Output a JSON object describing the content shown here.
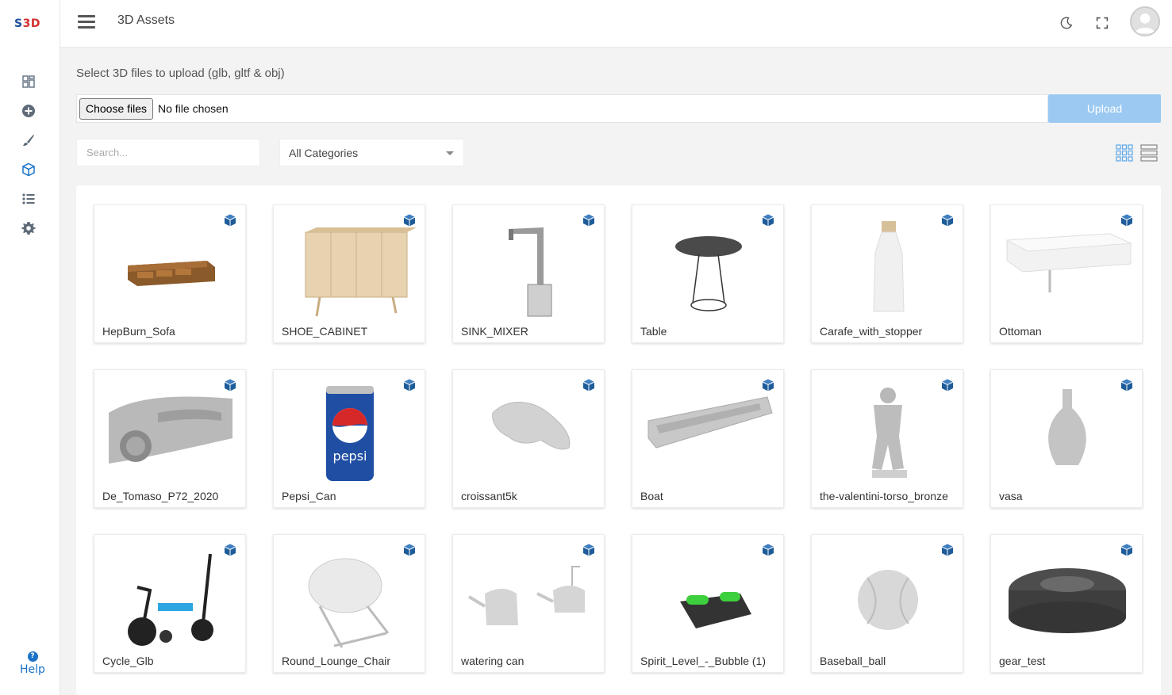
{
  "logo": {
    "text_a": "S",
    "text_b": "3D"
  },
  "header": {
    "title": "3D Assets"
  },
  "sidebar": {
    "icons": [
      "dashboard-icon",
      "add-circle-icon",
      "brush-icon",
      "cube-icon",
      "list-icon",
      "gear-icon"
    ],
    "help_label": "Help"
  },
  "upload": {
    "label": "Select 3D files to upload (glb, gltf & obj)",
    "choose_label": "Choose files",
    "no_file_label": "No file chosen",
    "upload_label": "Upload"
  },
  "filters": {
    "search_placeholder": "Search...",
    "category_value": "All Categories"
  },
  "colors": {
    "accent": "#1e5c99",
    "upload_button": "#9cc9f2",
    "logo_red": "#d32f2f",
    "logo_blue": "#1e4f9e"
  },
  "assets": [
    {
      "name": "HepBurn_Sofa",
      "thumb": "sofa"
    },
    {
      "name": "SHOE_CABINET",
      "thumb": "cabinet"
    },
    {
      "name": "SINK_MIXER",
      "thumb": "faucet"
    },
    {
      "name": "Table",
      "thumb": "table"
    },
    {
      "name": "Carafe_with_stopper",
      "thumb": "carafe"
    },
    {
      "name": "Ottoman",
      "thumb": "ottoman"
    },
    {
      "name": "De_Tomaso_P72_2020",
      "thumb": "car"
    },
    {
      "name": "Pepsi_Can",
      "thumb": "can"
    },
    {
      "name": "croissant5k",
      "thumb": "croissant"
    },
    {
      "name": "Boat",
      "thumb": "boat"
    },
    {
      "name": "the-valentini-torso_bronze",
      "thumb": "torso"
    },
    {
      "name": "vasa",
      "thumb": "vase"
    },
    {
      "name": "Cycle_Glb",
      "thumb": "tricycle"
    },
    {
      "name": "Round_Lounge_Chair",
      "thumb": "chair"
    },
    {
      "name": "watering can",
      "thumb": "watering-can"
    },
    {
      "name": "Spirit_Level_-_Bubble (1)",
      "thumb": "spirit-level"
    },
    {
      "name": "Baseball_ball",
      "thumb": "ball"
    },
    {
      "name": "gear_test",
      "thumb": "gear"
    }
  ]
}
